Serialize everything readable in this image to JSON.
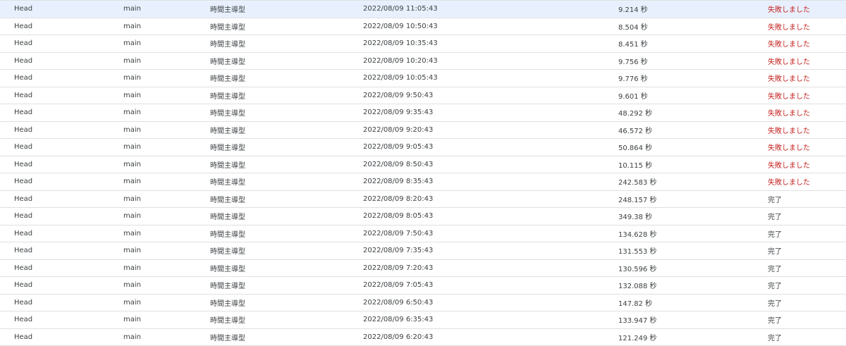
{
  "executions": [
    {
      "deployment": "Head",
      "function": "main",
      "trigger_type": "時間主導型",
      "start_time": "2022/08/09 11:05:43",
      "duration": "9.214 秒",
      "status": "失敗しました",
      "status_kind": "failed"
    },
    {
      "deployment": "Head",
      "function": "main",
      "trigger_type": "時間主導型",
      "start_time": "2022/08/09 10:50:43",
      "duration": "8.504 秒",
      "status": "失敗しました",
      "status_kind": "failed"
    },
    {
      "deployment": "Head",
      "function": "main",
      "trigger_type": "時間主導型",
      "start_time": "2022/08/09 10:35:43",
      "duration": "8.451 秒",
      "status": "失敗しました",
      "status_kind": "failed"
    },
    {
      "deployment": "Head",
      "function": "main",
      "trigger_type": "時間主導型",
      "start_time": "2022/08/09 10:20:43",
      "duration": "9.756 秒",
      "status": "失敗しました",
      "status_kind": "failed"
    },
    {
      "deployment": "Head",
      "function": "main",
      "trigger_type": "時間主導型",
      "start_time": "2022/08/09 10:05:43",
      "duration": "9.776 秒",
      "status": "失敗しました",
      "status_kind": "failed"
    },
    {
      "deployment": "Head",
      "function": "main",
      "trigger_type": "時間主導型",
      "start_time": "2022/08/09 9:50:43",
      "duration": "9.601 秒",
      "status": "失敗しました",
      "status_kind": "failed"
    },
    {
      "deployment": "Head",
      "function": "main",
      "trigger_type": "時間主導型",
      "start_time": "2022/08/09 9:35:43",
      "duration": "48.292 秒",
      "status": "失敗しました",
      "status_kind": "failed"
    },
    {
      "deployment": "Head",
      "function": "main",
      "trigger_type": "時間主導型",
      "start_time": "2022/08/09 9:20:43",
      "duration": "46.572 秒",
      "status": "失敗しました",
      "status_kind": "failed"
    },
    {
      "deployment": "Head",
      "function": "main",
      "trigger_type": "時間主導型",
      "start_time": "2022/08/09 9:05:43",
      "duration": "50.864 秒",
      "status": "失敗しました",
      "status_kind": "failed"
    },
    {
      "deployment": "Head",
      "function": "main",
      "trigger_type": "時間主導型",
      "start_time": "2022/08/09 8:50:43",
      "duration": "10.115 秒",
      "status": "失敗しました",
      "status_kind": "failed"
    },
    {
      "deployment": "Head",
      "function": "main",
      "trigger_type": "時間主導型",
      "start_time": "2022/08/09 8:35:43",
      "duration": "242.583 秒",
      "status": "失敗しました",
      "status_kind": "failed"
    },
    {
      "deployment": "Head",
      "function": "main",
      "trigger_type": "時間主導型",
      "start_time": "2022/08/09 8:20:43",
      "duration": "248.157 秒",
      "status": "完了",
      "status_kind": "done"
    },
    {
      "deployment": "Head",
      "function": "main",
      "trigger_type": "時間主導型",
      "start_time": "2022/08/09 8:05:43",
      "duration": "349.38 秒",
      "status": "完了",
      "status_kind": "done"
    },
    {
      "deployment": "Head",
      "function": "main",
      "trigger_type": "時間主導型",
      "start_time": "2022/08/09 7:50:43",
      "duration": "134.628 秒",
      "status": "完了",
      "status_kind": "done"
    },
    {
      "deployment": "Head",
      "function": "main",
      "trigger_type": "時間主導型",
      "start_time": "2022/08/09 7:35:43",
      "duration": "131.553 秒",
      "status": "完了",
      "status_kind": "done"
    },
    {
      "deployment": "Head",
      "function": "main",
      "trigger_type": "時間主導型",
      "start_time": "2022/08/09 7:20:43",
      "duration": "130.596 秒",
      "status": "完了",
      "status_kind": "done"
    },
    {
      "deployment": "Head",
      "function": "main",
      "trigger_type": "時間主導型",
      "start_time": "2022/08/09 7:05:43",
      "duration": "132.088 秒",
      "status": "完了",
      "status_kind": "done"
    },
    {
      "deployment": "Head",
      "function": "main",
      "trigger_type": "時間主導型",
      "start_time": "2022/08/09 6:50:43",
      "duration": "147.82 秒",
      "status": "完了",
      "status_kind": "done"
    },
    {
      "deployment": "Head",
      "function": "main",
      "trigger_type": "時間主導型",
      "start_time": "2022/08/09 6:35:43",
      "duration": "133.947 秒",
      "status": "完了",
      "status_kind": "done"
    },
    {
      "deployment": "Head",
      "function": "main",
      "trigger_type": "時間主導型",
      "start_time": "2022/08/09 6:20:43",
      "duration": "121.249 秒",
      "status": "完了",
      "status_kind": "done"
    }
  ],
  "selected_row": 0,
  "colors": {
    "failed": "#c5221f",
    "done": "#3c4043",
    "selected_row_bg": "#e8f0fe",
    "row_border": "#e0e0e0"
  }
}
